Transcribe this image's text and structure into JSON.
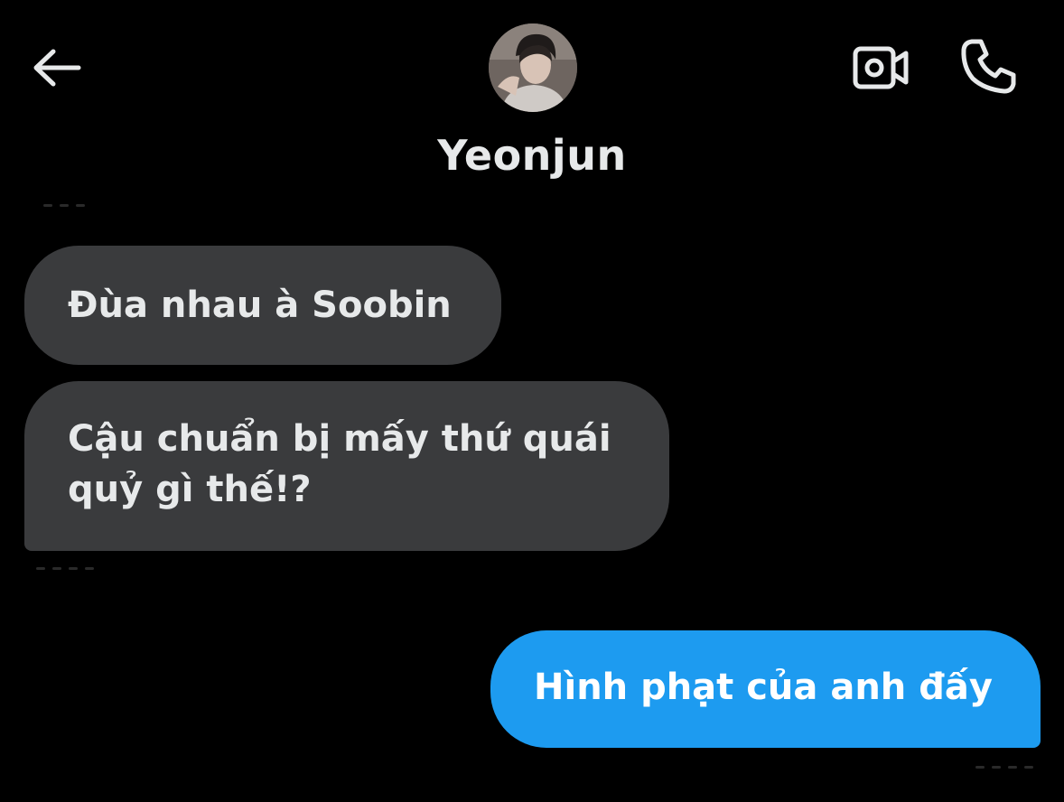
{
  "header": {
    "back_icon": "arrow-left-icon",
    "contact_name": "Yeonjun",
    "video_icon": "video-camera-icon",
    "call_icon": "phone-icon"
  },
  "messages": [
    {
      "direction": "incoming",
      "text": "Đùa nhau à Soobin"
    },
    {
      "direction": "incoming",
      "text": "Cậu chuẩn bị mấy thứ quái quỷ gì thế!?"
    },
    {
      "direction": "outgoing",
      "text": "Hình phạt của anh đấy"
    }
  ],
  "colors": {
    "background": "#000000",
    "incoming_bubble": "#3a3b3d",
    "outgoing_bubble": "#1d9bf0",
    "text": "#e7e9ea"
  }
}
